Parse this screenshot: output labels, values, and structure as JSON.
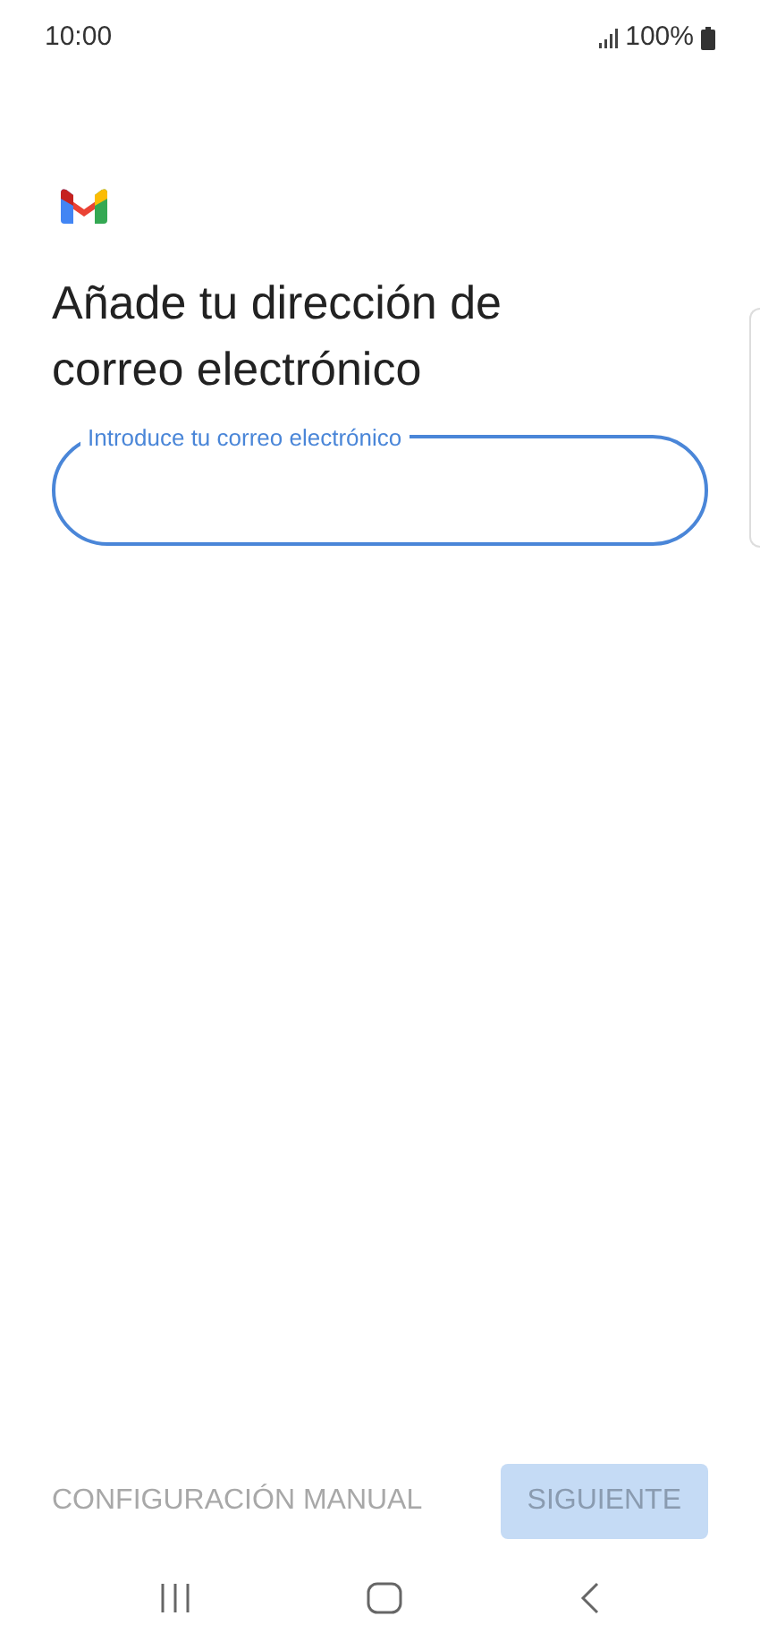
{
  "status_bar": {
    "time": "10:00",
    "battery": "100%"
  },
  "title": "Añade tu dirección de correo electrónico",
  "email_field": {
    "label": "Introduce tu correo electrónico",
    "focused": true
  },
  "buttons": [
    {
      "label": "CONFIGURACIÓN MANUAL",
      "kind": "text",
      "disabled": true
    },
    {
      "label": "SIGUIENTE",
      "kind": "filled",
      "disabled": true
    }
  ]
}
